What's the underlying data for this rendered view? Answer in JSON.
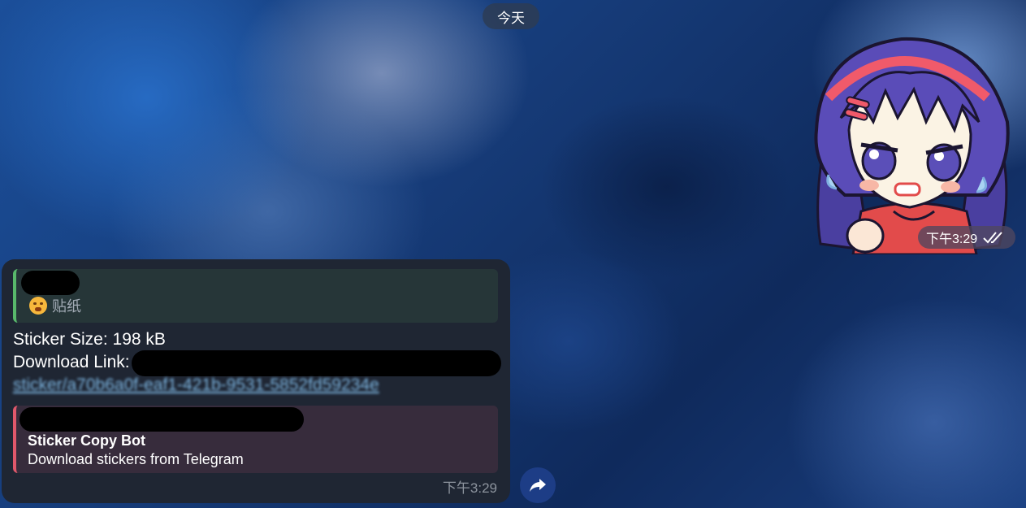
{
  "date_label": "今天",
  "sticker": {
    "time": "下午3:29",
    "status_icon": "double-check-icon"
  },
  "message": {
    "reply": {
      "preview_text": "贴纸",
      "emoji_icon": "steam-face-emoji-icon"
    },
    "sticker_size_label": "Sticker Size: 198 kB",
    "download_label": "Download Link:",
    "link_text": "sticker/a70b6a0f-eaf1-421b-9531-5852fd59234e",
    "link_preview": {
      "title": "Sticker Copy Bot",
      "description": "Download stickers from Telegram"
    },
    "time": "下午3:29"
  },
  "share_button_icon": "share-arrow-icon",
  "colors": {
    "bubble_bg": "#1f2633",
    "reply_accent": "#58b86b",
    "preview_accent": "#e0586b",
    "link": "#7fb8e4"
  }
}
